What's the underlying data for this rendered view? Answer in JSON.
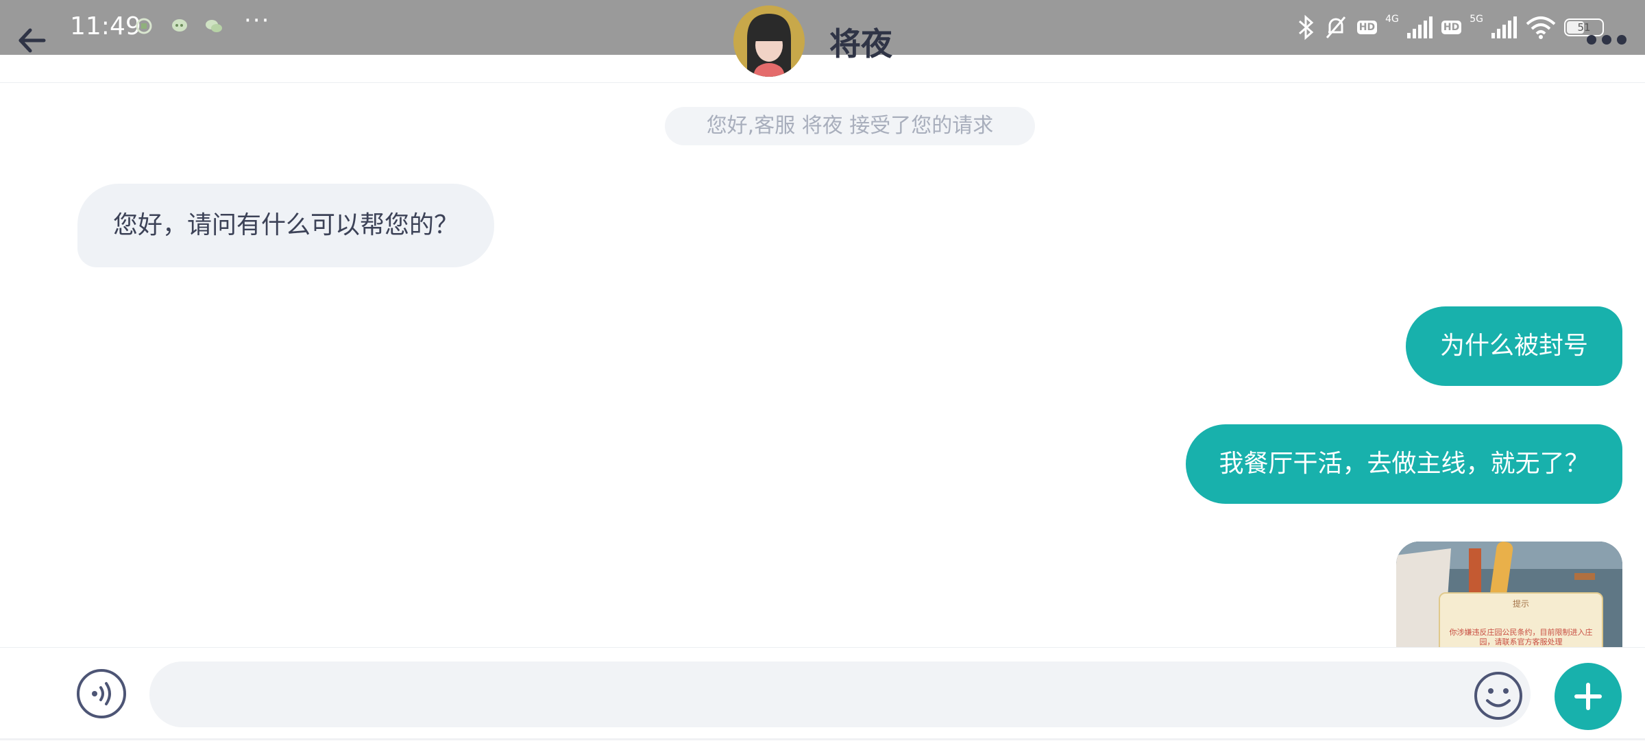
{
  "status_bar": {
    "time": "11:49",
    "overflow": "···",
    "network_1": "4G",
    "network_2": "5G",
    "hd_label": "HD",
    "battery": "51",
    "icons": [
      "bluetooth-icon",
      "mute-bell-icon",
      "signal-icon",
      "wifi-icon",
      "battery-icon"
    ]
  },
  "header": {
    "title": "将夜",
    "back_icon": "back-arrow-icon",
    "more_icon": "more-dots-icon"
  },
  "system_message": "您好,客服 将夜 接受了您的请求",
  "messages": [
    {
      "side": "incoming",
      "text": "您好，请问有什么可以帮您的？"
    },
    {
      "side": "outgoing",
      "text": "为什么被封号"
    },
    {
      "side": "outgoing",
      "text": "我餐厅干活，去做主线，就无了？"
    }
  ],
  "image_message": {
    "dialog_title": "提示",
    "dialog_text": "你涉嫌违反庄园公民条约，目前限制进入庄园，请联系官方客服处理"
  },
  "composer": {
    "input_value": "",
    "voice_icon": "voice-icon",
    "emoji_icon": "emoji-icon",
    "plus_icon": "plus-icon"
  },
  "colors": {
    "accent": "#18b1ac",
    "incoming_bubble": "#eff2f6",
    "title_text": "#2f3446",
    "status_bar": "#9a9a9a"
  }
}
